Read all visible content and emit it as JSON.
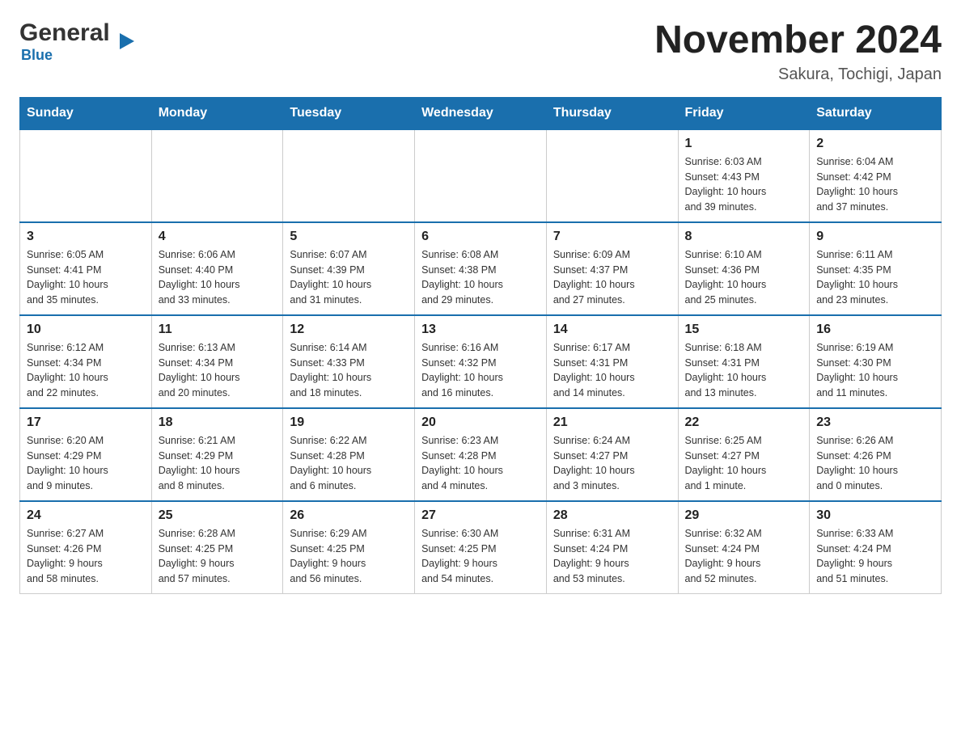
{
  "logo": {
    "name": "General",
    "color_name": "Blue"
  },
  "title": "November 2024",
  "location": "Sakura, Tochigi, Japan",
  "days_header": [
    "Sunday",
    "Monday",
    "Tuesday",
    "Wednesday",
    "Thursday",
    "Friday",
    "Saturday"
  ],
  "weeks": [
    [
      {
        "day": "",
        "info": ""
      },
      {
        "day": "",
        "info": ""
      },
      {
        "day": "",
        "info": ""
      },
      {
        "day": "",
        "info": ""
      },
      {
        "day": "",
        "info": ""
      },
      {
        "day": "1",
        "info": "Sunrise: 6:03 AM\nSunset: 4:43 PM\nDaylight: 10 hours\nand 39 minutes."
      },
      {
        "day": "2",
        "info": "Sunrise: 6:04 AM\nSunset: 4:42 PM\nDaylight: 10 hours\nand 37 minutes."
      }
    ],
    [
      {
        "day": "3",
        "info": "Sunrise: 6:05 AM\nSunset: 4:41 PM\nDaylight: 10 hours\nand 35 minutes."
      },
      {
        "day": "4",
        "info": "Sunrise: 6:06 AM\nSunset: 4:40 PM\nDaylight: 10 hours\nand 33 minutes."
      },
      {
        "day": "5",
        "info": "Sunrise: 6:07 AM\nSunset: 4:39 PM\nDaylight: 10 hours\nand 31 minutes."
      },
      {
        "day": "6",
        "info": "Sunrise: 6:08 AM\nSunset: 4:38 PM\nDaylight: 10 hours\nand 29 minutes."
      },
      {
        "day": "7",
        "info": "Sunrise: 6:09 AM\nSunset: 4:37 PM\nDaylight: 10 hours\nand 27 minutes."
      },
      {
        "day": "8",
        "info": "Sunrise: 6:10 AM\nSunset: 4:36 PM\nDaylight: 10 hours\nand 25 minutes."
      },
      {
        "day": "9",
        "info": "Sunrise: 6:11 AM\nSunset: 4:35 PM\nDaylight: 10 hours\nand 23 minutes."
      }
    ],
    [
      {
        "day": "10",
        "info": "Sunrise: 6:12 AM\nSunset: 4:34 PM\nDaylight: 10 hours\nand 22 minutes."
      },
      {
        "day": "11",
        "info": "Sunrise: 6:13 AM\nSunset: 4:34 PM\nDaylight: 10 hours\nand 20 minutes."
      },
      {
        "day": "12",
        "info": "Sunrise: 6:14 AM\nSunset: 4:33 PM\nDaylight: 10 hours\nand 18 minutes."
      },
      {
        "day": "13",
        "info": "Sunrise: 6:16 AM\nSunset: 4:32 PM\nDaylight: 10 hours\nand 16 minutes."
      },
      {
        "day": "14",
        "info": "Sunrise: 6:17 AM\nSunset: 4:31 PM\nDaylight: 10 hours\nand 14 minutes."
      },
      {
        "day": "15",
        "info": "Sunrise: 6:18 AM\nSunset: 4:31 PM\nDaylight: 10 hours\nand 13 minutes."
      },
      {
        "day": "16",
        "info": "Sunrise: 6:19 AM\nSunset: 4:30 PM\nDaylight: 10 hours\nand 11 minutes."
      }
    ],
    [
      {
        "day": "17",
        "info": "Sunrise: 6:20 AM\nSunset: 4:29 PM\nDaylight: 10 hours\nand 9 minutes."
      },
      {
        "day": "18",
        "info": "Sunrise: 6:21 AM\nSunset: 4:29 PM\nDaylight: 10 hours\nand 8 minutes."
      },
      {
        "day": "19",
        "info": "Sunrise: 6:22 AM\nSunset: 4:28 PM\nDaylight: 10 hours\nand 6 minutes."
      },
      {
        "day": "20",
        "info": "Sunrise: 6:23 AM\nSunset: 4:28 PM\nDaylight: 10 hours\nand 4 minutes."
      },
      {
        "day": "21",
        "info": "Sunrise: 6:24 AM\nSunset: 4:27 PM\nDaylight: 10 hours\nand 3 minutes."
      },
      {
        "day": "22",
        "info": "Sunrise: 6:25 AM\nSunset: 4:27 PM\nDaylight: 10 hours\nand 1 minute."
      },
      {
        "day": "23",
        "info": "Sunrise: 6:26 AM\nSunset: 4:26 PM\nDaylight: 10 hours\nand 0 minutes."
      }
    ],
    [
      {
        "day": "24",
        "info": "Sunrise: 6:27 AM\nSunset: 4:26 PM\nDaylight: 9 hours\nand 58 minutes."
      },
      {
        "day": "25",
        "info": "Sunrise: 6:28 AM\nSunset: 4:25 PM\nDaylight: 9 hours\nand 57 minutes."
      },
      {
        "day": "26",
        "info": "Sunrise: 6:29 AM\nSunset: 4:25 PM\nDaylight: 9 hours\nand 56 minutes."
      },
      {
        "day": "27",
        "info": "Sunrise: 6:30 AM\nSunset: 4:25 PM\nDaylight: 9 hours\nand 54 minutes."
      },
      {
        "day": "28",
        "info": "Sunrise: 6:31 AM\nSunset: 4:24 PM\nDaylight: 9 hours\nand 53 minutes."
      },
      {
        "day": "29",
        "info": "Sunrise: 6:32 AM\nSunset: 4:24 PM\nDaylight: 9 hours\nand 52 minutes."
      },
      {
        "day": "30",
        "info": "Sunrise: 6:33 AM\nSunset: 4:24 PM\nDaylight: 9 hours\nand 51 minutes."
      }
    ]
  ]
}
